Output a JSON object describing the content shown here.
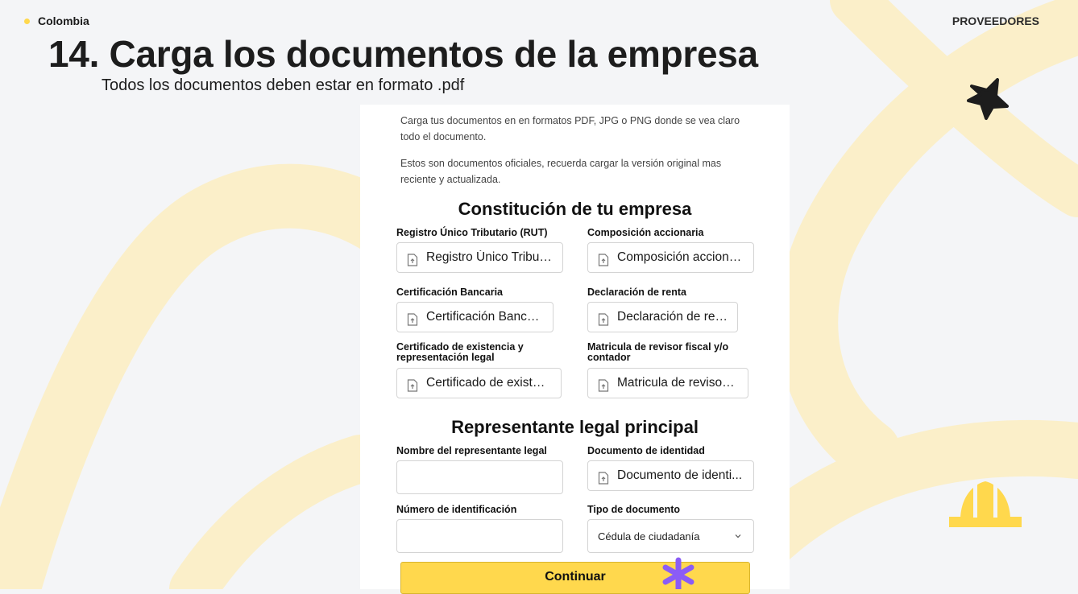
{
  "header": {
    "country": "Colombia",
    "section": "PROVEEDORES"
  },
  "page": {
    "title": "14. Carga los documentos de la empresa",
    "subtitle": "Todos los documentos deben estar en formato .pdf"
  },
  "form": {
    "intro_1": "Carga tus documentos en en formatos PDF, JPG o PNG donde se vea claro todo el documento.",
    "intro_2": "Estos son documentos oficiales, recuerda cargar la versión original mas reciente y actualizada.",
    "section_company": "Constitución de tu empresa",
    "rut": {
      "label": "Registro Único Tributario (RUT)",
      "button": "Registro Único Tribut..."
    },
    "shares": {
      "label": "Composición accionaria",
      "button": "Composición acciona..."
    },
    "bank": {
      "label": "Certificación Bancaria",
      "button": "Certificación Bancaria"
    },
    "tax": {
      "label": "Declaración de renta",
      "button": "Declaración de renta"
    },
    "existence": {
      "label_line1": "Certificado de existencia y",
      "label_line2": "representación legal",
      "button": "Certificado de existen..."
    },
    "auditor": {
      "label_line1": "Matricula de revisor fiscal y/o",
      "label_line2": "contador",
      "button": "Matricula de revisor f..."
    },
    "section_rep": "Representante legal principal",
    "rep_name": {
      "label": "Nombre del representante legal",
      "value": ""
    },
    "rep_doc": {
      "label": "Documento de identidad",
      "button": "Documento de identi..."
    },
    "rep_id_number": {
      "label": "Número de identificación",
      "value": ""
    },
    "doc_type": {
      "label": "Tipo de documento",
      "selected": "Cédula de ciudadanía"
    },
    "continue_label": "Continuar"
  },
  "icons": {
    "file_upload": "file-upload-icon",
    "chevron": "chevron-down-icon",
    "asterisk": "asterisk-icon",
    "star": "star-icon",
    "helmet": "hard-hat-icon"
  },
  "colors": {
    "accent_yellow": "#ffd84d",
    "asterisk_purple": "#8b5cf6",
    "background": "#f4f5f7",
    "decor_cream": "#fbefc9"
  }
}
